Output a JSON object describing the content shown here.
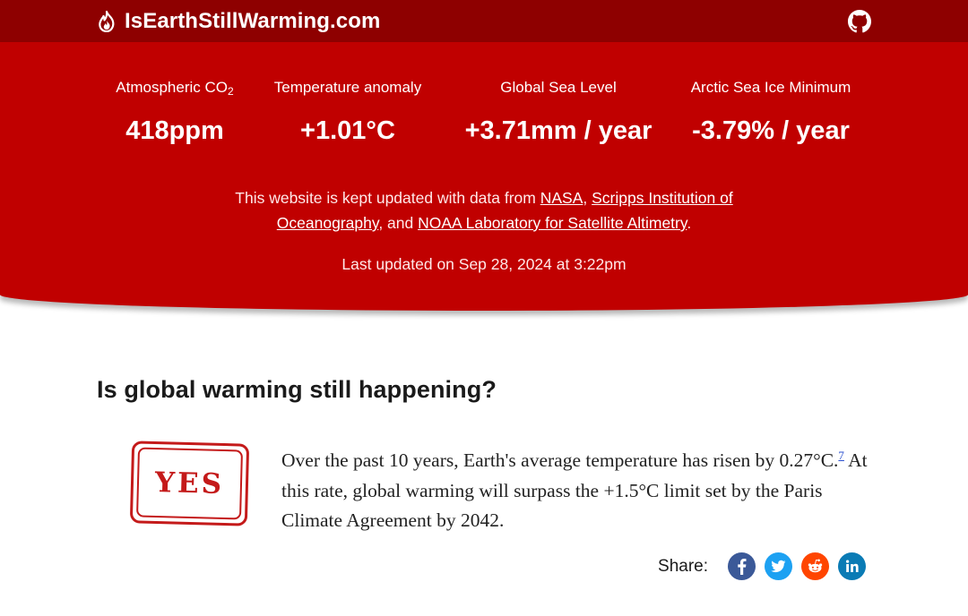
{
  "header": {
    "title": "IsEarthStillWarming.com",
    "icon": "flame-icon",
    "github_icon": "github-icon"
  },
  "stats": [
    {
      "label": "Atmospheric CO",
      "label_sub": "2",
      "value": "418ppm"
    },
    {
      "label": "Temperature anomaly",
      "value": "+1.01°C"
    },
    {
      "label": "Global Sea Level",
      "value": "+3.71mm / year"
    },
    {
      "label": "Arctic Sea Ice Minimum",
      "value": "-3.79% / year"
    }
  ],
  "sources": {
    "intro": "This website is kept updated with data from ",
    "link1": "NASA",
    "sep1": ", ",
    "link2": "Scripps Institution of Oceanography",
    "sep2": ", and ",
    "link3": "NOAA Laboratory for Satellite Altimetry",
    "end": "."
  },
  "updated": "Last updated on Sep 28, 2024 at 3:22pm",
  "question": "Is global warming still happening?",
  "stamp": "YES",
  "answer": {
    "part1": "Over the past 10 years, Earth's average temperature has risen by 0.27°C.",
    "footnote": "7",
    "part2": " At this rate, global warming will surpass the +1.5°C limit set by the Paris Climate Agreement by 2042."
  },
  "share": {
    "label": "Share:",
    "buttons": [
      {
        "name": "facebook",
        "icon": "facebook-icon",
        "color": "#3b5998"
      },
      {
        "name": "twitter",
        "icon": "twitter-icon",
        "color": "#1da1f2"
      },
      {
        "name": "reddit",
        "icon": "reddit-icon",
        "color": "#ff4500"
      },
      {
        "name": "linkedin",
        "icon": "linkedin-icon",
        "color": "#0a7bb5"
      }
    ]
  },
  "colors": {
    "topbar": "#8e0000",
    "hero": "#c00000",
    "stamp": "#c41a1a"
  }
}
